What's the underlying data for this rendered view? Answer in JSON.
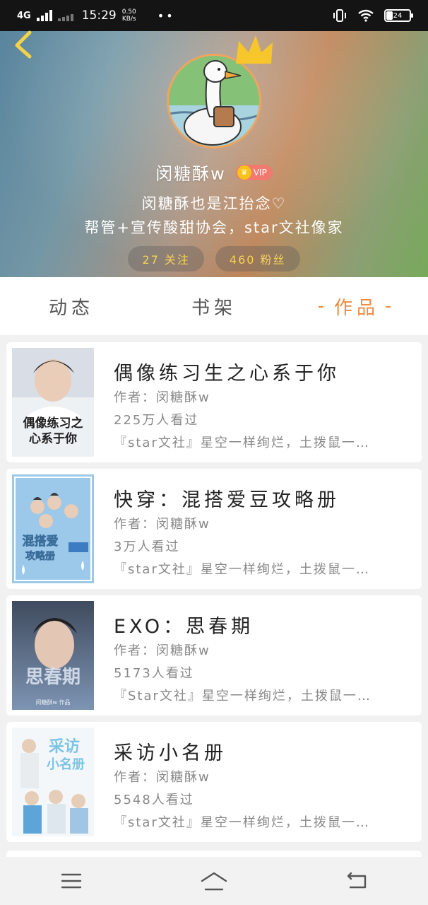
{
  "status_bar": {
    "network": "4G",
    "hd": "HD",
    "time": "15:29",
    "speed_value": "0.50",
    "speed_unit": "KB/s",
    "dots": "••",
    "battery": "24"
  },
  "profile": {
    "username": "闵糖酥w",
    "vip_label": "VIP",
    "bio_line1": "闵糖酥也是江抬念♡",
    "bio_line2": "帮管+宣传酸甜协会，star文社像家",
    "following_label": "27 关注",
    "followers_label": "460 粉丝"
  },
  "tabs": [
    {
      "label": "动态",
      "active": false
    },
    {
      "label": "书架",
      "active": false
    },
    {
      "label": "作品",
      "active": true
    }
  ],
  "tab_active_decor": "-",
  "books": [
    {
      "title": "偶像练习生之心系于你",
      "author": "作者：闵糖酥w",
      "views": "225万人看过",
      "desc": "『star文社』星空一样绚烂，土拨鼠一…",
      "cover_text": "偶像练习之心系于你"
    },
    {
      "title": "快穿：混搭爱豆攻略册",
      "author": "作者：闵糖酥w",
      "views": "3万人看过",
      "desc": "『star文社』星空一样绚烂，土拨鼠一…",
      "cover_text": "混搭爱豆攻略册"
    },
    {
      "title": "EXO：思春期",
      "author": "作者：闵糖酥w",
      "views": "5173人看过",
      "desc": "『Star文社』星空一样绚烂，土拨鼠一…",
      "cover_text": "思春期"
    },
    {
      "title": "采访小名册",
      "author": "作者：闵糖酥w",
      "views": "5548人看过",
      "desc": "『star文社』星空一样绚烂，土拨鼠一…",
      "cover_text": "采访小名册"
    }
  ],
  "colors": {
    "accent": "#f08a3e",
    "stat_text": "#f6d35a",
    "vip_bg": "#f07a6e",
    "avatar_border": "#f0a45e"
  },
  "icons": {
    "back": "chevron-left-icon",
    "crown": "crown-icon",
    "menu": "menu-icon",
    "home": "home-icon",
    "return": "return-icon"
  }
}
